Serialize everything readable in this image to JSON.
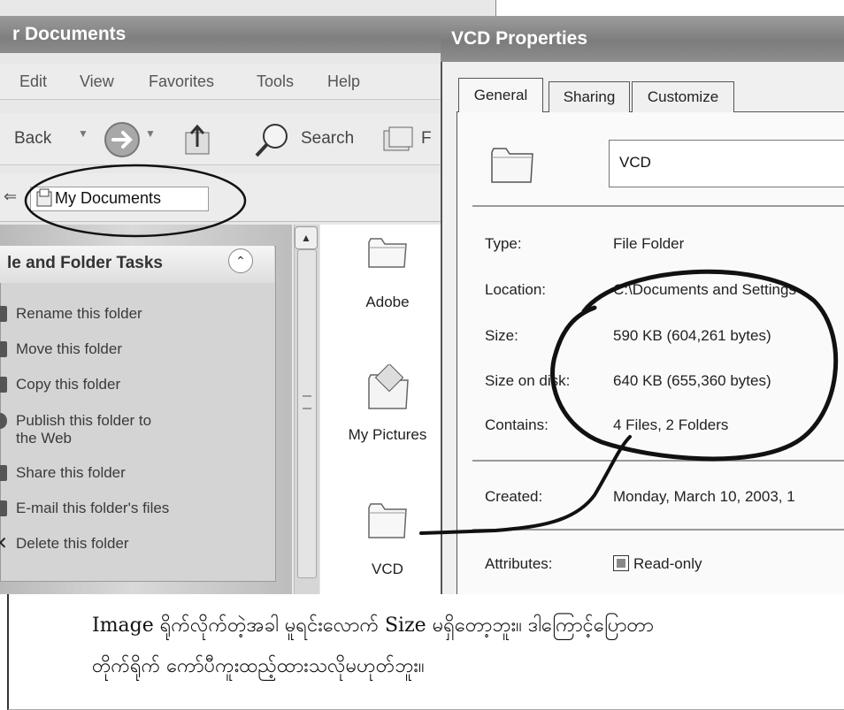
{
  "explorer": {
    "title": "r Documents",
    "menu": [
      "Edit",
      "View",
      "Favorites",
      "Tools",
      "Help"
    ],
    "toolbar": {
      "back": "Back",
      "search": "Search",
      "folders_fragment": "F"
    },
    "address": "My Documents",
    "task_pane": {
      "title": "le and Folder Tasks",
      "items": [
        "Rename this folder",
        "Move this folder",
        "Copy this folder",
        "Publish this folder to",
        "the Web",
        "Share this folder",
        "E-mail this folder's files",
        "Delete this folder"
      ]
    },
    "files": [
      {
        "name": "Adobe",
        "icon": "folder-icon"
      },
      {
        "name": "My Pictures",
        "icon": "pictures-folder-icon"
      },
      {
        "name": "VCD",
        "icon": "folder-icon"
      }
    ]
  },
  "properties": {
    "title": "VCD Properties",
    "tabs": [
      "General",
      "Sharing",
      "Customize"
    ],
    "folder_name": "VCD",
    "rows": [
      {
        "label": "Type:",
        "value": "File Folder"
      },
      {
        "label": "Location:",
        "value": "C:\\Documents and Settings"
      },
      {
        "label": "Size:",
        "value": "590 KB (604,261 bytes)"
      },
      {
        "label": "Size on disk:",
        "value": "640 KB (655,360 bytes)"
      },
      {
        "label": "Contains:",
        "value": "4 Files, 2 Folders"
      },
      {
        "label": "Created:",
        "value": "Monday, March 10, 2003, 1"
      },
      {
        "label": "Attributes:",
        "value": "Read-only"
      }
    ]
  },
  "caption": {
    "line1": "Image ရိုက်လိုက်တဲ့အခါ မူရင်းလောက် Size မရှိတော့ဘူး။ ဒါကြောင့်ပြောတာ",
    "line2": "တိုက်ရိုက် ကော်ပီကူးထည့်ထားသလိုမဟုတ်ဘူး။"
  },
  "colors": {
    "title_bar": "#888888",
    "dialog_bg": "#f0f0f0",
    "annotation_ink": "#111111"
  }
}
